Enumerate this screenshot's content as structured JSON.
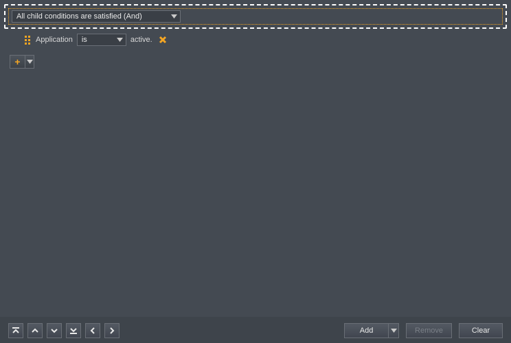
{
  "group": {
    "conditionSelector": "All child conditions are satisfied (And)"
  },
  "child": {
    "label": "Application",
    "operator": "is",
    "suffix": "active."
  },
  "footer": {
    "add": "Add",
    "remove": "Remove",
    "clear": "Clear"
  }
}
